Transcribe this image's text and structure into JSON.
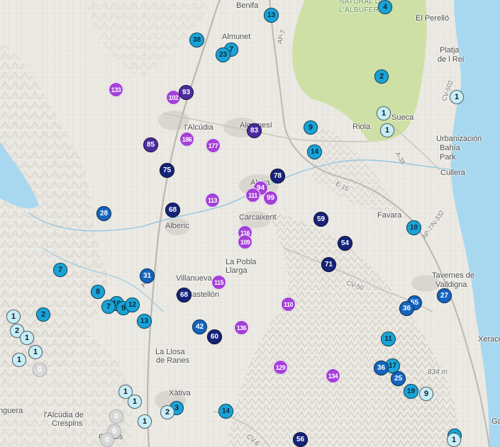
{
  "map": {
    "colors": {
      "tier1": "#c6eef8",
      "tier2": "#1aa3d6",
      "tier3": "#1565c0",
      "tier4": "#15237a",
      "tier5": "#4a2ca0",
      "tier6": "#a43fd8",
      "zero": "#c9c9c9",
      "park": "#cfe0a6",
      "sea": "#a8d8ef",
      "land": "#eceae4"
    },
    "places": [
      {
        "label": "Benifa",
        "cls": "town"
      },
      {
        "label": "NATURAL DE",
        "cls": "park"
      },
      {
        "label": "L'ALBUFERA",
        "cls": "park"
      },
      {
        "label": "El Perelló",
        "cls": "town"
      },
      {
        "label": "Almunet",
        "cls": "town"
      },
      {
        "label": "Platja",
        "cls": "town"
      },
      {
        "label": "de l Rei",
        "cls": "town"
      },
      {
        "label": "Sueca",
        "cls": "town"
      },
      {
        "label": "Riola",
        "cls": "town"
      },
      {
        "label": "Urbanización",
        "cls": "town"
      },
      {
        "label": "Bahía",
        "cls": "town"
      },
      {
        "label": "Park",
        "cls": "town"
      },
      {
        "label": "Cullera",
        "cls": "town"
      },
      {
        "label": "l'Alcúdia",
        "cls": "town"
      },
      {
        "label": "Algemesí",
        "cls": "town"
      },
      {
        "label": "Alzira",
        "cls": "town"
      },
      {
        "label": "Carcaixent",
        "cls": "town"
      },
      {
        "label": "Alberic",
        "cls": "town"
      },
      {
        "label": "La Pobla",
        "cls": "town"
      },
      {
        "label": "Llarga",
        "cls": "town"
      },
      {
        "label": "Villanueva",
        "cls": "town"
      },
      {
        "label": "de Castellón",
        "cls": "town"
      },
      {
        "label": "Favara",
        "cls": "town"
      },
      {
        "label": "Tavernes de",
        "cls": "town"
      },
      {
        "label": "Valldigna",
        "cls": "town"
      },
      {
        "label": "Xeraco",
        "cls": "town"
      },
      {
        "label": "La Llosa",
        "cls": "town"
      },
      {
        "label": "de Ranes",
        "cls": "town"
      },
      {
        "label": "Xàtiva",
        "cls": "town"
      },
      {
        "label": "l'Alcúdia de",
        "cls": "town"
      },
      {
        "label": "Crespins",
        "cls": "town"
      },
      {
        "label": "Canals",
        "cls": "town"
      },
      {
        "label": "nguera",
        "cls": "town"
      },
      {
        "label": "Ga",
        "cls": "town"
      },
      {
        "label": "AP-7",
        "cls": "road"
      },
      {
        "label": "CV-502",
        "cls": "road"
      },
      {
        "label": "A-38",
        "cls": "road"
      },
      {
        "label": "E-15",
        "cls": "road"
      },
      {
        "label": "CV-50",
        "cls": "road"
      },
      {
        "label": "A-7",
        "cls": "road"
      },
      {
        "label": "AP-7/N-332",
        "cls": "road"
      },
      {
        "label": "CV-6",
        "cls": "road"
      },
      {
        "label": "834 m",
        "cls": "elev"
      }
    ],
    "markers": [
      {
        "v": "13",
        "t": "tier2"
      },
      {
        "v": "4",
        "t": "tier2"
      },
      {
        "v": "38",
        "t": "tier2"
      },
      {
        "v": "7",
        "t": "tier2"
      },
      {
        "v": "23",
        "t": "tier2"
      },
      {
        "v": "2",
        "t": "tier2"
      },
      {
        "v": "1",
        "t": "tier1"
      },
      {
        "v": "133",
        "t": "tier6"
      },
      {
        "v": "102",
        "t": "tier6"
      },
      {
        "v": "93",
        "t": "tier5"
      },
      {
        "v": "1",
        "t": "tier1"
      },
      {
        "v": "1",
        "t": "tier1"
      },
      {
        "v": "9",
        "t": "tier2"
      },
      {
        "v": "83",
        "t": "tier5"
      },
      {
        "v": "186",
        "t": "tier6"
      },
      {
        "v": "177",
        "t": "tier6"
      },
      {
        "v": "85",
        "t": "tier5"
      },
      {
        "v": "14",
        "t": "tier2"
      },
      {
        "v": "75",
        "t": "tier4"
      },
      {
        "v": "78",
        "t": "tier4"
      },
      {
        "v": "94",
        "t": "tier6"
      },
      {
        "v": "111",
        "t": "tier6"
      },
      {
        "v": "99",
        "t": "tier6"
      },
      {
        "v": "113",
        "t": "tier6"
      },
      {
        "v": "28",
        "t": "tier3"
      },
      {
        "v": "68",
        "t": "tier4"
      },
      {
        "v": "59",
        "t": "tier4"
      },
      {
        "v": "116",
        "t": "tier6"
      },
      {
        "v": "109",
        "t": "tier6"
      },
      {
        "v": "10",
        "t": "tier2"
      },
      {
        "v": "54",
        "t": "tier4"
      },
      {
        "v": "71",
        "t": "tier4"
      },
      {
        "v": "7",
        "t": "tier2"
      },
      {
        "v": "31",
        "t": "tier3"
      },
      {
        "v": "115",
        "t": "tier6"
      },
      {
        "v": "8",
        "t": "tier2"
      },
      {
        "v": "68",
        "t": "tier4"
      },
      {
        "v": "110",
        "t": "tier6"
      },
      {
        "v": "55",
        "t": "tier3"
      },
      {
        "v": "27",
        "t": "tier3"
      },
      {
        "v": "10",
        "t": "tier2"
      },
      {
        "v": "7",
        "t": "tier2"
      },
      {
        "v": "9",
        "t": "tier2"
      },
      {
        "v": "12",
        "t": "tier2"
      },
      {
        "v": "36",
        "t": "tier3"
      },
      {
        "v": "2",
        "t": "tier2"
      },
      {
        "v": "1",
        "t": "tier1"
      },
      {
        "v": "13",
        "t": "tier2"
      },
      {
        "v": "42",
        "t": "tier3"
      },
      {
        "v": "136",
        "t": "tier6"
      },
      {
        "v": "2",
        "t": "tier1"
      },
      {
        "v": "1",
        "t": "tier1"
      },
      {
        "v": "60",
        "t": "tier4"
      },
      {
        "v": "11",
        "t": "tier2"
      },
      {
        "v": "1",
        "t": "tier1"
      },
      {
        "v": "1",
        "t": "tier1"
      },
      {
        "v": "0",
        "t": "zero"
      },
      {
        "v": "129",
        "t": "tier6"
      },
      {
        "v": "134",
        "t": "tier6"
      },
      {
        "v": "17",
        "t": "tier2"
      },
      {
        "v": "36",
        "t": "tier3"
      },
      {
        "v": "25",
        "t": "tier3"
      },
      {
        "v": "19",
        "t": "tier2"
      },
      {
        "v": "9",
        "t": "tier1"
      },
      {
        "v": "1",
        "t": "tier1"
      },
      {
        "v": "1",
        "t": "tier1"
      },
      {
        "v": "1",
        "t": "tier1"
      },
      {
        "v": "3",
        "t": "tier2"
      },
      {
        "v": "2",
        "t": "tier1"
      },
      {
        "v": "14",
        "t": "tier2"
      },
      {
        "v": "0",
        "t": "zero"
      },
      {
        "v": "0",
        "t": "zero"
      },
      {
        "v": "0",
        "t": "zero"
      },
      {
        "v": "56",
        "t": "tier4"
      },
      {
        "v": "4",
        "t": "tier2"
      },
      {
        "v": "1",
        "t": "tier1"
      }
    ]
  }
}
